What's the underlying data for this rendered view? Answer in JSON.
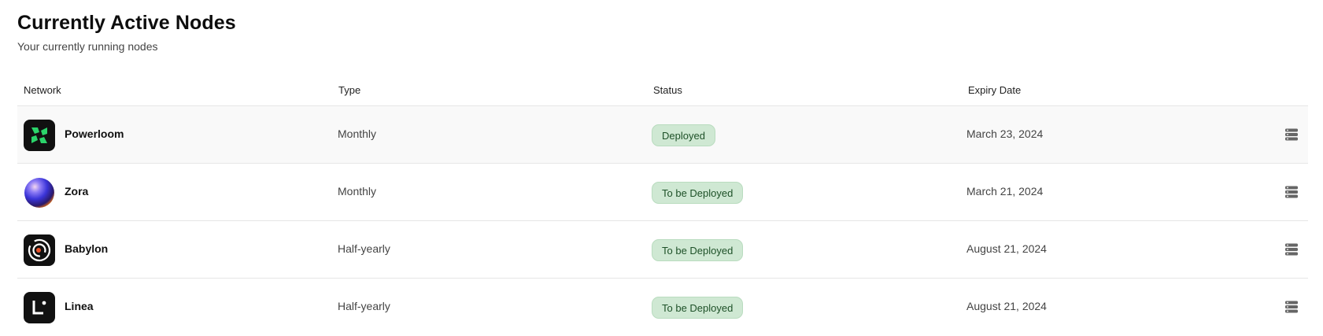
{
  "header": {
    "title": "Currently Active Nodes",
    "subtitle": "Your currently running nodes"
  },
  "table": {
    "columns": [
      "Network",
      "Type",
      "Status",
      "Expiry Date"
    ],
    "rows": [
      {
        "network": "Powerloom",
        "logo": "powerloom-logo",
        "type": "Monthly",
        "status": "Deployed",
        "expiry": "March 23, 2024",
        "action_icon": "server-icon"
      },
      {
        "network": "Zora",
        "logo": "zora-logo",
        "type": "Monthly",
        "status": "To be Deployed",
        "expiry": "March 21, 2024",
        "action_icon": "server-icon"
      },
      {
        "network": "Babylon",
        "logo": "babylon-logo",
        "type": "Half-yearly",
        "status": "To be Deployed",
        "expiry": "August 21, 2024",
        "action_icon": "server-icon"
      },
      {
        "network": "Linea",
        "logo": "linea-logo",
        "type": "Half-yearly",
        "status": "To be Deployed",
        "expiry": "August 21, 2024",
        "action_icon": "server-icon"
      }
    ]
  },
  "colors": {
    "status_badge_bg": "#cfe8d3",
    "status_badge_text": "#1e5128",
    "powerloom_accent": "#2bd46a",
    "babylon_accent": "#e8532b"
  }
}
